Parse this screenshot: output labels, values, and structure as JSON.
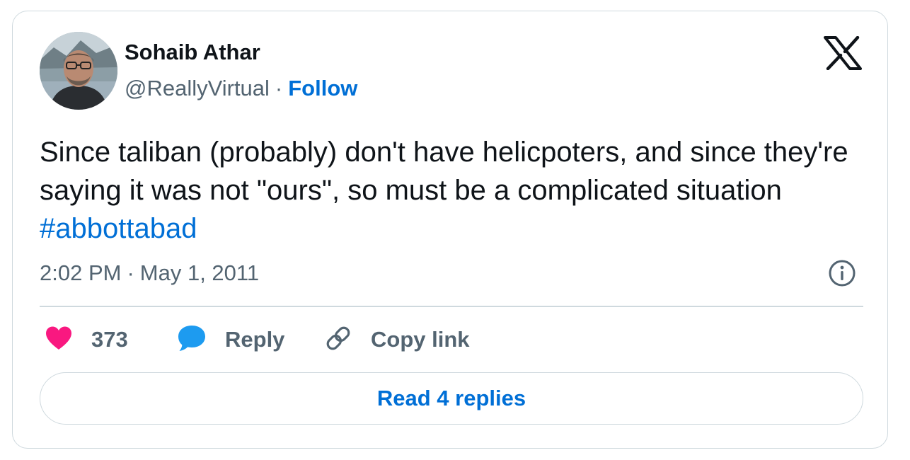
{
  "author": {
    "name": "Sohaib Athar",
    "handle": "@ReallyVirtual",
    "separator": "·",
    "follow_label": "Follow"
  },
  "tweet": {
    "text": "Since taliban (probably) don't have helicpoters, and since they're saying it was not \"ours\", so must be a complicated situation ",
    "hashtag": "#abbottabad",
    "time": "2:02 PM",
    "separator": "·",
    "date": "May 1, 2011"
  },
  "actions": {
    "like_count": "373",
    "reply_label": "Reply",
    "copy_link_label": "Copy link"
  },
  "read_replies_label": "Read 4 replies",
  "icons": {
    "brand": "x-logo-icon",
    "info": "info-icon",
    "like": "heart-icon",
    "reply": "speech-bubble-icon",
    "copy": "link-icon"
  },
  "colors": {
    "link_blue": "#006fd6",
    "heart_pink": "#f91880",
    "bubble_blue": "#1d9bf0",
    "muted_text": "#536471",
    "border": "#cfd9de"
  }
}
